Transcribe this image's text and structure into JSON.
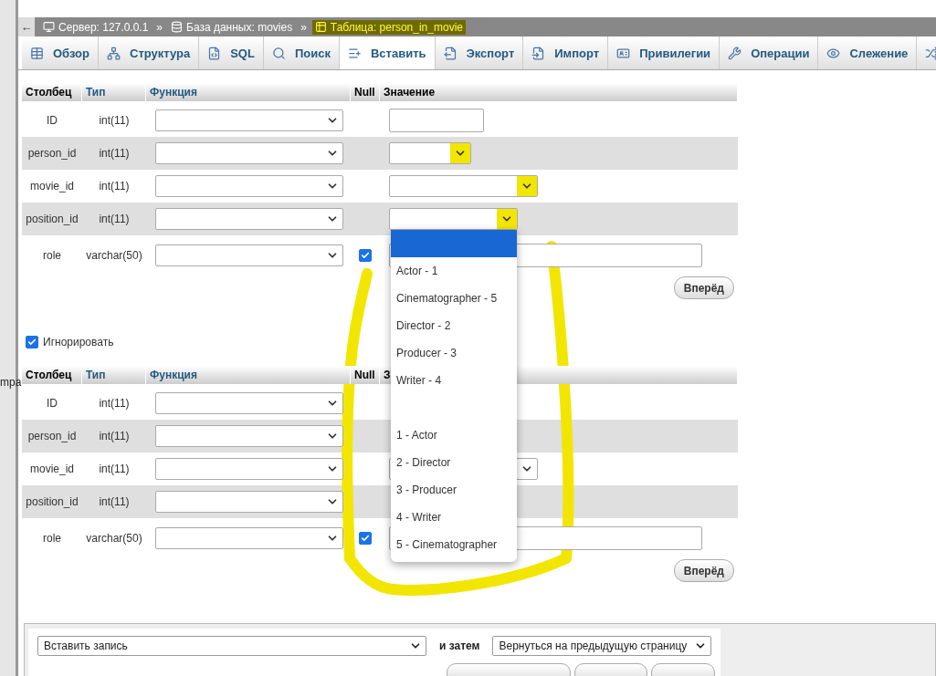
{
  "side_text": "mpa",
  "breadcrumb": {
    "back": "←",
    "items": [
      {
        "kind": "server",
        "label": "Сервер: 127.0.0.1"
      },
      {
        "kind": "separator",
        "label": "»"
      },
      {
        "kind": "database",
        "label": "База данных: movies"
      },
      {
        "kind": "separator",
        "label": "»"
      },
      {
        "kind": "table",
        "label": "Таблица: person_in_movie",
        "highlighted": true
      }
    ]
  },
  "tabs": [
    {
      "label": "Обзор",
      "selected": false
    },
    {
      "label": "Структура",
      "selected": false
    },
    {
      "label": "SQL",
      "selected": false
    },
    {
      "label": "Поиск",
      "selected": false
    },
    {
      "label": "Вставить",
      "selected": true
    },
    {
      "label": "Экспорт",
      "selected": false
    },
    {
      "label": "Импорт",
      "selected": false
    },
    {
      "label": "Привилегии",
      "selected": false
    },
    {
      "label": "Операции",
      "selected": false
    },
    {
      "label": "Слежение",
      "selected": false
    },
    {
      "selected": false
    }
  ],
  "forms": [
    {
      "headers": {
        "column": "Столбец",
        "type": "Тип",
        "function": "Функция",
        "null": "Null",
        "value": "Значение"
      },
      "rows": [
        {
          "name": "ID",
          "type": "int(11)",
          "value_field": {
            "kind": "text"
          }
        },
        {
          "name": "person_id",
          "type": "int(11)",
          "value_field": {
            "kind": "select",
            "highlighted": true
          }
        },
        {
          "name": "movie_id",
          "type": "int(11)",
          "value_field": {
            "kind": "select",
            "highlighted": true
          }
        },
        {
          "name": "position_id",
          "type": "int(11)",
          "value_field": {
            "kind": "select",
            "open": true,
            "highlighted": true
          }
        },
        {
          "name": "role",
          "type": "varchar(50)",
          "null": {
            "checked": true
          },
          "value_field": {
            "kind": "text"
          }
        }
      ],
      "submit": "Вперёд"
    },
    {
      "headers": {
        "column": "Столбец",
        "type": "Тип",
        "function": "Функция",
        "null": "Null",
        "value": "З"
      },
      "rows": [
        {
          "name": "ID",
          "type": "int(11)"
        },
        {
          "name": "person_id",
          "type": "int(11)"
        },
        {
          "name": "movie_id",
          "type": "int(11)",
          "value_field": {
            "kind": "select"
          }
        },
        {
          "name": "position_id",
          "type": "int(11)"
        },
        {
          "name": "role",
          "type": "varchar(50)",
          "null": {
            "checked": true
          },
          "value_field": {
            "kind": "text"
          }
        }
      ],
      "submit": "Вперёд"
    }
  ],
  "ignore": {
    "label": "Игнорировать",
    "checked": true
  },
  "dropdown": {
    "blank_option": {
      "selected": true
    },
    "options": [
      {
        "label": "Actor - 1",
        "selected": false
      },
      {
        "label": "Cinematographer - 5",
        "selected": false
      },
      {
        "label": "Director - 2",
        "selected": false
      },
      {
        "label": "Producer - 3",
        "selected": false
      },
      {
        "label": "Writer - 4",
        "selected": false
      }
    ],
    "options_by_id": [
      {
        "label": "1 - Actor",
        "selected": false
      },
      {
        "label": "2 - Director",
        "selected": false
      },
      {
        "label": "3 - Producer",
        "selected": false
      },
      {
        "label": "4 - Writer",
        "selected": false
      },
      {
        "label": "5 - Cinematographer",
        "selected": false
      }
    ]
  },
  "footer": {
    "action": "Вставить запись",
    "then_label": "и затем",
    "after": "Вернуться на предыдущую страницу"
  }
}
